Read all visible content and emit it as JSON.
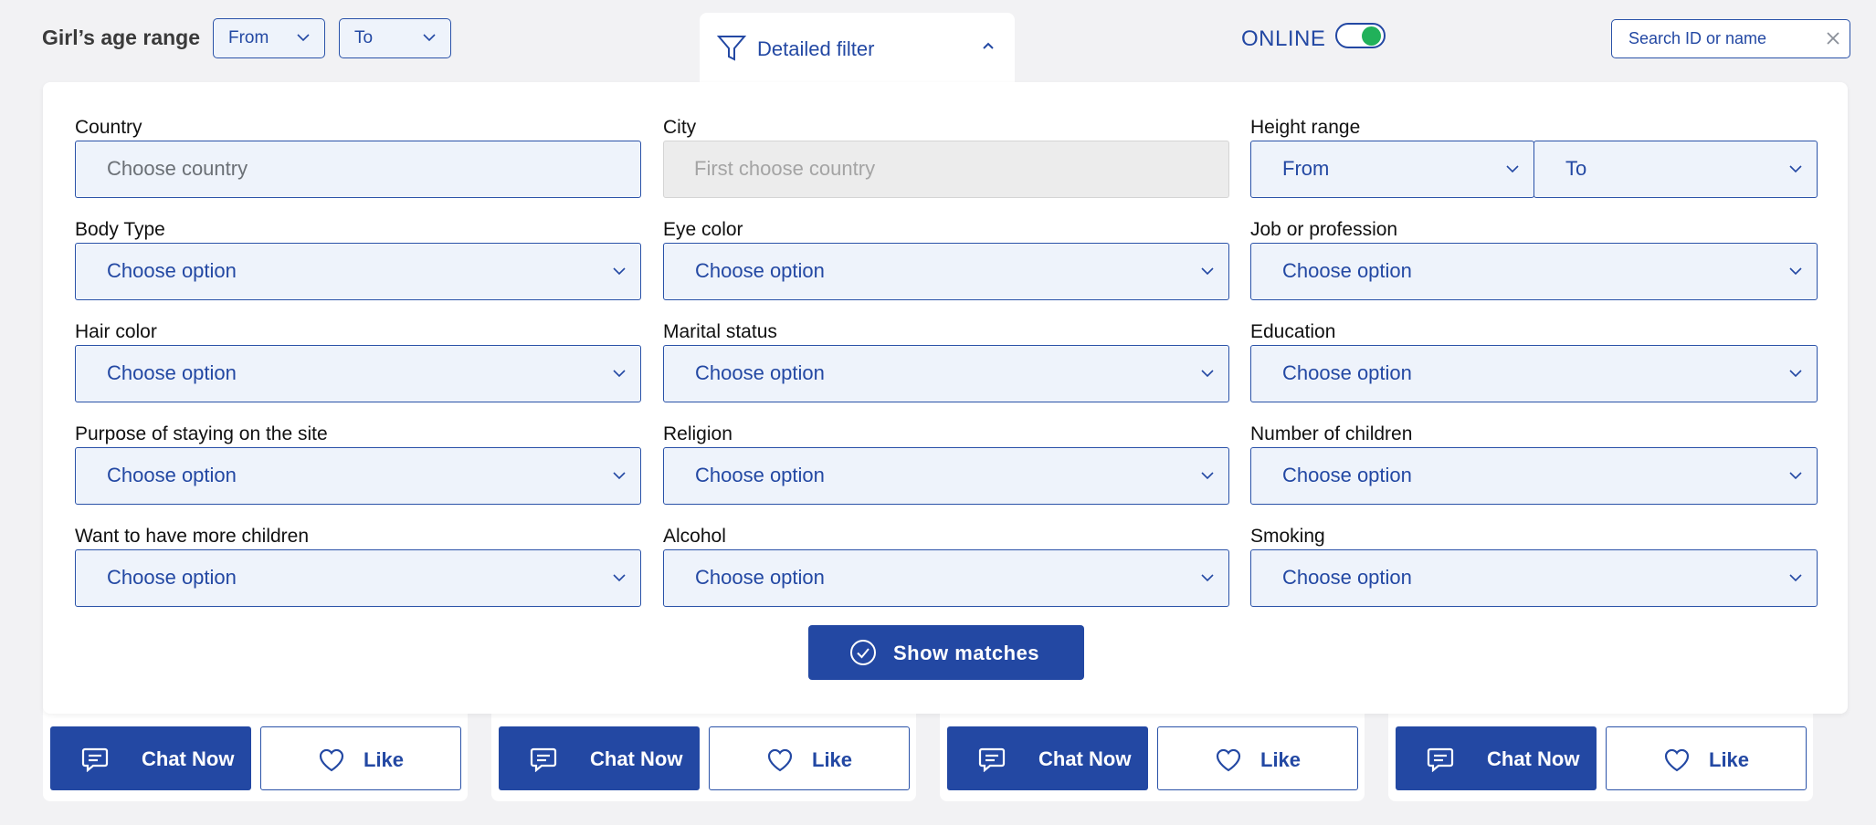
{
  "topbar": {
    "age_label": "Girl’s age range",
    "age_from": "From",
    "age_to": "To",
    "detailed_filter": "Detailed filter",
    "online_label": "ONLINE",
    "online_enabled": true,
    "search_placeholder": "Search ID or name"
  },
  "filters": {
    "country": {
      "label": "Country",
      "value": "Choose country"
    },
    "city": {
      "label": "City",
      "value": "First choose country"
    },
    "height": {
      "label": "Height range",
      "from": "From",
      "to": "To"
    },
    "body_type": {
      "label": "Body Type",
      "value": "Choose option"
    },
    "eye_color": {
      "label": "Eye color",
      "value": "Choose option"
    },
    "job": {
      "label": "Job or profession",
      "value": "Choose option"
    },
    "hair_color": {
      "label": "Hair color",
      "value": "Choose option"
    },
    "marital_status": {
      "label": "Marital status",
      "value": "Choose option"
    },
    "education": {
      "label": "Education",
      "value": "Choose option"
    },
    "purpose": {
      "label": "Purpose of staying on the site",
      "value": "Choose option"
    },
    "religion": {
      "label": "Religion",
      "value": "Choose option"
    },
    "children": {
      "label": "Number of children",
      "value": "Choose option"
    },
    "more_children": {
      "label": "Want to have more children",
      "value": "Choose option"
    },
    "alcohol": {
      "label": "Alcohol",
      "value": "Choose option"
    },
    "smoking": {
      "label": "Smoking",
      "value": "Choose option"
    }
  },
  "show_matches": "Show matches",
  "cards": {
    "chat_label": "Chat Now",
    "like_label": "Like"
  },
  "colors": {
    "accent": "#2348a3",
    "online_dot": "#21b15a",
    "field_bg": "#eef3fb"
  }
}
